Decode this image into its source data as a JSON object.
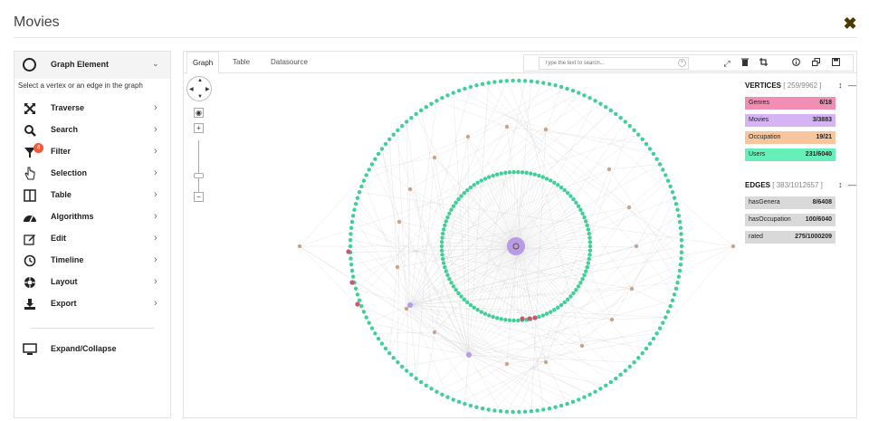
{
  "window": {
    "title": "Movies"
  },
  "sidebar": {
    "header": {
      "label": "Graph Element",
      "icon": "circle-icon"
    },
    "hint": "Select a vertex or an edge in the graph",
    "items": [
      {
        "label": "Traverse",
        "icon": "expand-arrows-icon"
      },
      {
        "label": "Search",
        "icon": "magnifier-icon"
      },
      {
        "label": "Filter",
        "icon": "funnel-icon",
        "badge": "4"
      },
      {
        "label": "Selection",
        "icon": "hand-pointer-icon"
      },
      {
        "label": "Table",
        "icon": "table-columns-icon"
      },
      {
        "label": "Algorithms",
        "icon": "dashboard-gauge-icon"
      },
      {
        "label": "Edit",
        "icon": "pencil-square-icon"
      },
      {
        "label": "Timeline",
        "icon": "clock-icon"
      },
      {
        "label": "Layout",
        "icon": "life-ring-icon"
      },
      {
        "label": "Export",
        "icon": "download-tray-icon"
      }
    ],
    "footer": {
      "label": "Expand/Collapse",
      "icon": "monitor-icon"
    }
  },
  "tabs": [
    {
      "label": "Graph",
      "active": true
    },
    {
      "label": "Table",
      "active": false
    },
    {
      "label": "Datasource",
      "active": false
    }
  ],
  "search": {
    "placeholder": "Type the text to search..."
  },
  "toolbar": {
    "icons": [
      "fit-screen-icon",
      "trash-icon",
      "crop-icon",
      "info-icon",
      "window-restore-icon",
      "save-icon"
    ]
  },
  "legend": {
    "vertices": {
      "title": "VERTICES",
      "count": "[ 259/9962 ]",
      "rows": [
        {
          "label": "Genres",
          "value": "6/18",
          "color": "#f08fb3"
        },
        {
          "label": "Movies",
          "value": "3/3883",
          "color": "#d5b3f5"
        },
        {
          "label": "Occupation",
          "value": "19/21",
          "color": "#f7c69d"
        },
        {
          "label": "Users",
          "value": "231/6040",
          "color": "#66efb8"
        }
      ]
    },
    "edges": {
      "title": "EDGES",
      "count": "[ 383/1012657 ]",
      "rows": [
        {
          "label": "hasGenera",
          "value": "8/6408",
          "color": "#d9d9d9"
        },
        {
          "label": "hasOccupation",
          "value": "100/6040",
          "color": "#d9d9d9"
        },
        {
          "label": "rated",
          "value": "275/1000209",
          "color": "#d9d9d9"
        }
      ]
    }
  },
  "graph": {
    "colors": {
      "user": "#3fcf97",
      "genre": "#c9586f",
      "movie": "#b89be6",
      "occupation": "#c9a488",
      "edge": "#c8c8c8"
    }
  }
}
